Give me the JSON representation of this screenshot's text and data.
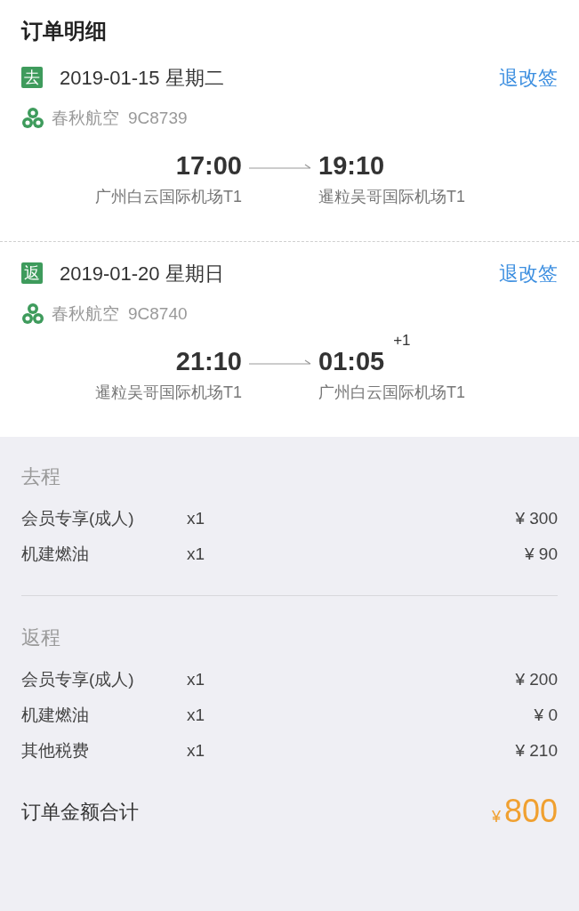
{
  "title": "订单明细",
  "legs": [
    {
      "badge": "去",
      "date": "2019-01-15 星期二",
      "change_link": "退改签",
      "airline": "春秋航空",
      "flight": "9C8739",
      "depart_time": "17:00",
      "arrive_time": "19:10",
      "depart_airport": "广州白云国际机场T1",
      "arrive_airport": "暹粒吴哥国际机场T1"
    },
    {
      "badge": "返",
      "date": "2019-01-20 星期日",
      "change_link": "退改签",
      "airline": "春秋航空",
      "flight": "9C8740",
      "depart_time": "21:10",
      "arrive_time": "01:05",
      "day_offset": "+1",
      "depart_airport": "暹粒吴哥国际机场T1",
      "arrive_airport": "广州白云国际机场T1"
    }
  ],
  "price_groups": [
    {
      "label": "去程",
      "items": [
        {
          "name": "会员专享(成人)",
          "qty": "x1",
          "price": "¥ 300"
        },
        {
          "name": "机建燃油",
          "qty": "x1",
          "price": "¥ 90"
        }
      ]
    },
    {
      "label": "返程",
      "items": [
        {
          "name": "会员专享(成人)",
          "qty": "x1",
          "price": "¥ 200"
        },
        {
          "name": "机建燃油",
          "qty": "x1",
          "price": "¥ 0"
        },
        {
          "name": "其他税费",
          "qty": "x1",
          "price": "¥ 210"
        }
      ]
    }
  ],
  "total": {
    "label": "订单金额合计",
    "currency": "¥",
    "amount": "800"
  }
}
